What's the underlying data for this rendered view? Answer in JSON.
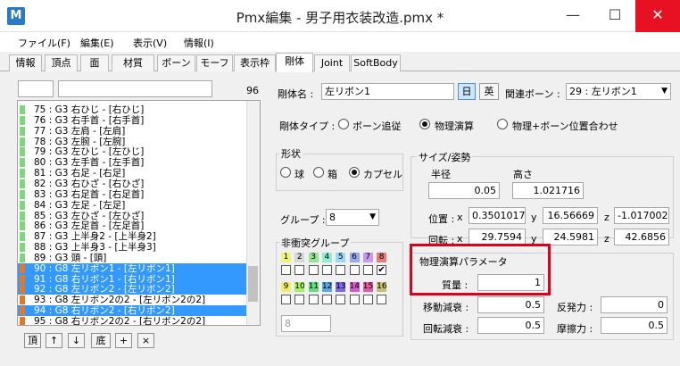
{
  "window": {
    "title": "Pmx編集 - 男子用衣装改造.pmx *",
    "icon_letter": "M"
  },
  "menu": [
    "ファイル(F)",
    "編集(E)",
    "表示(V)",
    "情報(I)"
  ],
  "tabs": [
    "情報",
    "頂点",
    "面",
    "材質",
    "ボーン",
    "モーフ",
    "表示枠",
    "剛体",
    "Joint",
    "SoftBody"
  ],
  "active_tab": "剛体",
  "left": {
    "filter_value": "",
    "search_value": "",
    "count": "96",
    "rows": [
      {
        "text": "75 : G3  右ひじ  - [右ひじ]",
        "color": "#7ed67e",
        "selected": false
      },
      {
        "text": "76 : G3  右手首  - [右手首]",
        "color": "#7ed67e",
        "selected": false
      },
      {
        "text": "77 : G3  左肩  - [左肩]",
        "color": "#7ed67e",
        "selected": false
      },
      {
        "text": "78 : G3  左腕  - [左腕]",
        "color": "#7ed67e",
        "selected": false
      },
      {
        "text": "79 : G3  左ひじ  - [左ひじ]",
        "color": "#7ed67e",
        "selected": false
      },
      {
        "text": "80 : G3  左手首  - [左手首]",
        "color": "#7ed67e",
        "selected": false
      },
      {
        "text": "81 : G3  右足  - [右足]",
        "color": "#7ed67e",
        "selected": false
      },
      {
        "text": "82 : G3  右ひざ  - [右ひざ]",
        "color": "#7ed67e",
        "selected": false
      },
      {
        "text": "83 : G3  右足首  - [右足首]",
        "color": "#7ed67e",
        "selected": false
      },
      {
        "text": "84 : G3  左足  - [左足]",
        "color": "#7ed67e",
        "selected": false
      },
      {
        "text": "85 : G3  左ひざ  - [左ひざ]",
        "color": "#7ed67e",
        "selected": false
      },
      {
        "text": "86 : G3  左足首  - [左足首]",
        "color": "#7ed67e",
        "selected": false
      },
      {
        "text": "87 : G3  上半身2  - [上半身2]",
        "color": "#7ed67e",
        "selected": false
      },
      {
        "text": "88 : G3  上半身3  - [上半身3]",
        "color": "#7ed67e",
        "selected": false
      },
      {
        "text": "89 : G3  頭  - [頭]",
        "color": "#7ed67e",
        "selected": false
      },
      {
        "text": "90 : G8  左リボン1  - [左リボン1]",
        "color": "#e07a2a",
        "selected": true
      },
      {
        "text": "91 : G8  右リボン1  - [右リボン1]",
        "color": "#e07a2a",
        "selected": true
      },
      {
        "text": "92 : G8  左リボン2  - [左リボン2]",
        "color": "#e07a2a",
        "selected": true
      },
      {
        "text": "93 : G8  左リボン2の2  - [左リボン2の2]",
        "color": "#e07a2a",
        "selected": false
      },
      {
        "text": "94 : G8  右リボン2  - [右リボン2]",
        "color": "#e07a2a",
        "selected": true
      },
      {
        "text": "95 : G8  右リボン2の2  - [右リボン2の2]",
        "color": "#e07a2a",
        "selected": false
      }
    ],
    "buttons": [
      "頂",
      "↑",
      "↓",
      "底",
      "+",
      "×"
    ]
  },
  "right": {
    "name_label": "剛体名 :",
    "name_value": "左リボン1",
    "btn_jp": "日",
    "btn_en": "英",
    "bone_label": "関連ボーン :",
    "bone_value": "29 : 左リボン1",
    "type_label": "剛体タイプ :",
    "type_options": [
      "ボーン追従",
      "物理演算",
      "物理+ボーン位置合わせ"
    ],
    "type_selected": 1,
    "shape_label": "形状",
    "shape_options": [
      "球",
      "箱",
      "カプセル"
    ],
    "shape_selected": 2,
    "group_label": "グループ :",
    "group_value": "8",
    "nocollide_label": "非衝突グループ",
    "nocollide_row1": [
      "1",
      "2",
      "3",
      "4",
      "5",
      "6",
      "7",
      "8"
    ],
    "nocollide_row2": [
      "9",
      "10",
      "11",
      "12",
      "13",
      "14",
      "15",
      "16"
    ],
    "nocollide_colors1": [
      "#f2f27a",
      "#d7d7d7",
      "#97e397",
      "#8ef0d0",
      "#9cd7f5",
      "#9aa8f0",
      "#c79af0",
      "#e87a7a"
    ],
    "nocollide_colors2": [
      "#f2ef63",
      "#a6f25a",
      "#5ee07a",
      "#5aa7e8",
      "#7a6ae8",
      "#d35ad3",
      "#e85aa3",
      "#c8c070"
    ],
    "nocollide_checked": [
      8
    ],
    "nocollide_value": "8",
    "size_label": "サイズ/姿勢",
    "radius_label": "半径",
    "radius_value": "0.05",
    "height_label": "高さ",
    "height_value": "1.021716",
    "pos_label": "位置 :",
    "rot_label": "回転 :",
    "pos": {
      "x": "0.3501017",
      "y": "16.56669",
      "z": "-1.017002"
    },
    "rot": {
      "x": "29.7594",
      "y": "24.5981",
      "z": "42.6856"
    },
    "x_label": "x",
    "y_label": "y",
    "z_label": "z",
    "physics_label": "物理演算パラメータ",
    "mass_label": "質量 :",
    "mass_value": "1",
    "move_damp_label": "移動減衰 :",
    "move_damp_value": "0.5",
    "rot_damp_label": "回転減衰 :",
    "rot_damp_value": "0.5",
    "restitution_label": "反発力 :",
    "restitution_value": "0",
    "friction_label": "摩擦力 :",
    "friction_value": "0.5"
  }
}
